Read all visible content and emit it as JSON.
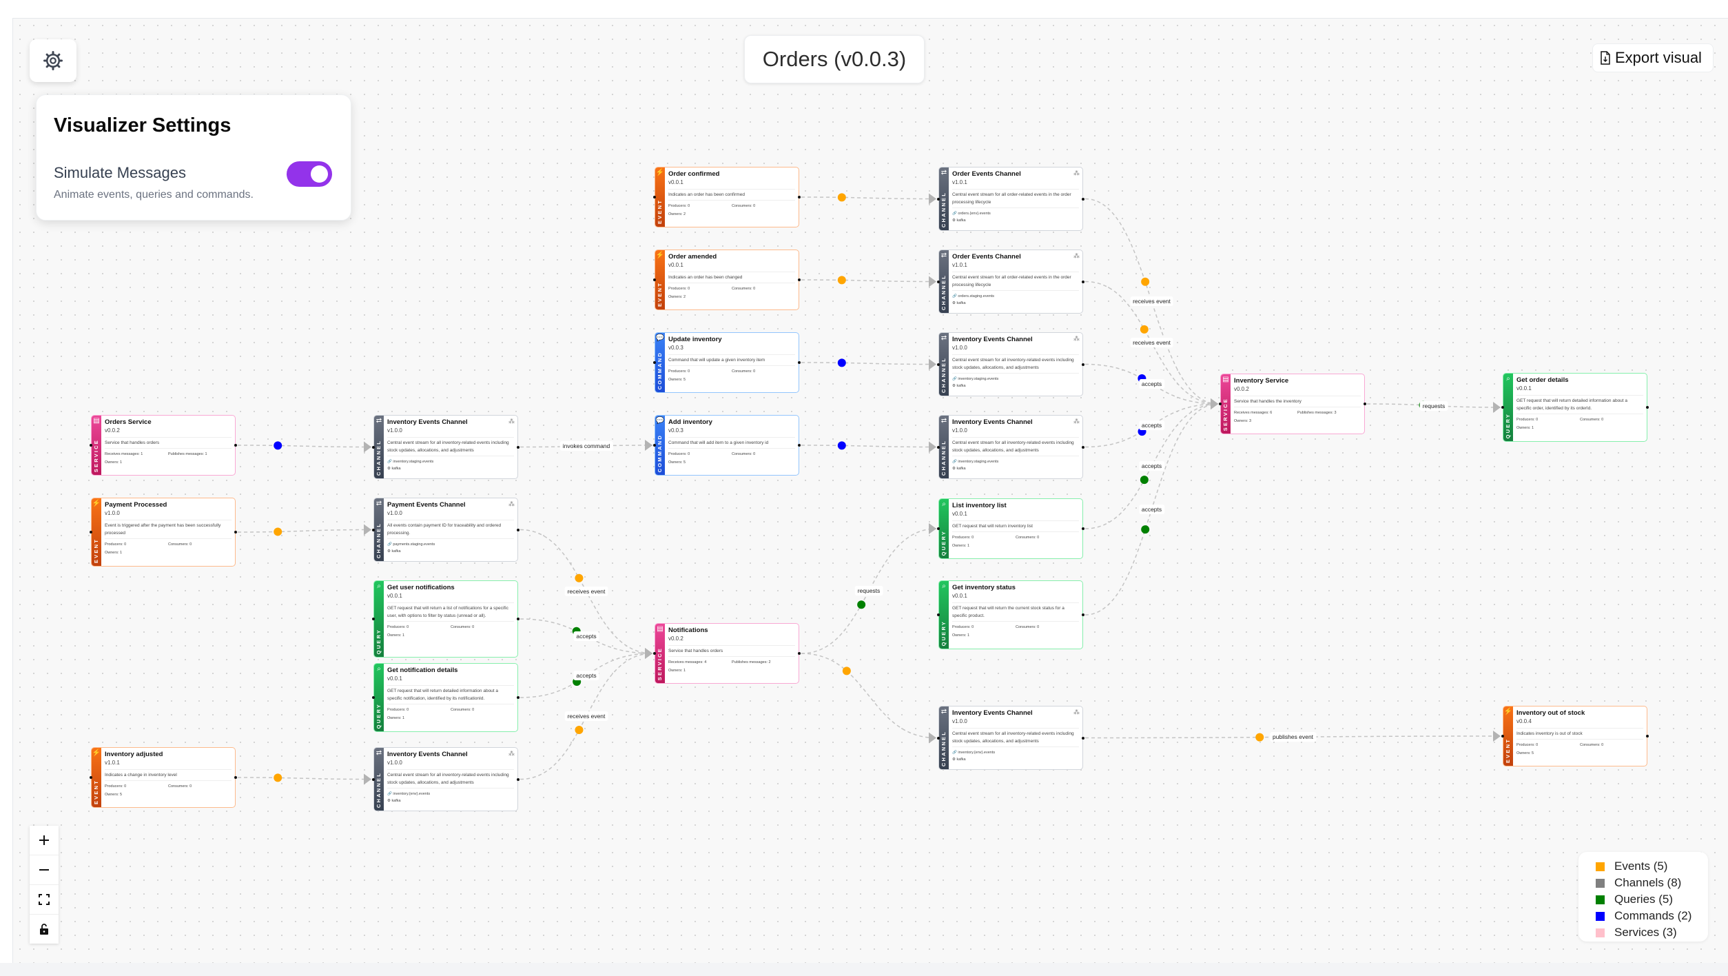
{
  "header": {
    "title": "Orders (v0.0.3)",
    "export_label": "Export visual"
  },
  "settings": {
    "title": "Visualizer Settings",
    "simulate_label": "Simulate Messages",
    "simulate_desc": "Animate events, queries and commands.",
    "simulate_enabled": true
  },
  "colors": {
    "event": "#f97316",
    "channel": "#4b5563",
    "command": "#2563eb",
    "query": "#16a34a",
    "service": "#db2777",
    "toggle": "#9333ea",
    "dot_event": "#ffa500",
    "dot_command": "#0000ff",
    "dot_query": "#008000"
  },
  "legend": [
    {
      "label": "Events (5)",
      "color": "#ffa500"
    },
    {
      "label": "Channels (8)",
      "color": "#808080"
    },
    {
      "label": "Queries (5)",
      "color": "#008000"
    },
    {
      "label": "Commands (2)",
      "color": "#0000ff"
    },
    {
      "label": "Services (3)",
      "color": "#ffc0cb"
    }
  ],
  "zoom_controls": [
    {
      "name": "zoom-in-button",
      "icon": "plus-icon"
    },
    {
      "name": "zoom-out-button",
      "icon": "minus-icon"
    },
    {
      "name": "fit-view-button",
      "icon": "fit-view-icon"
    },
    {
      "name": "toggle-interactivity-button",
      "icon": "unlock-icon"
    }
  ],
  "nodes": [
    {
      "id": "order-confirmed",
      "kind": "event",
      "band": "EVENT",
      "title": "Order confirmed",
      "version": "v0.0.1",
      "desc": "Indicates an order has been confirmed",
      "meta_left": "Producers: 0",
      "meta_right": "Consumers: 0",
      "owners": "Owners: 2"
    },
    {
      "id": "order-amended",
      "kind": "event",
      "band": "EVENT",
      "title": "Order amended",
      "version": "v0.0.1",
      "desc": "Indicates an order has been changed",
      "meta_left": "Producers: 0",
      "meta_right": "Consumers: 0",
      "owners": "Owners: 2"
    },
    {
      "id": "update-inventory",
      "kind": "command",
      "band": "COMMAND",
      "title": "Update inventory",
      "version": "v0.0.3",
      "desc": "Command that will update a given inventory item",
      "meta_left": "Producers: 0",
      "meta_right": "Consumers: 0",
      "owners": "Owners: 5"
    },
    {
      "id": "add-inventory",
      "kind": "command",
      "band": "COMMAND",
      "title": "Add inventory",
      "version": "v0.0.3",
      "desc": "Command that will add item to a given inventory id",
      "meta_left": "Producers: 0",
      "meta_right": "Consumers: 0",
      "owners": "Owners: 5"
    },
    {
      "id": "order-events-channel-1",
      "kind": "channel",
      "band": "CHANNEL",
      "title": "Order Events Channel",
      "version": "v1.0.1",
      "desc": "Central event stream for all order-related events in the order processing lifecycle",
      "topic": "orders.{env}.events",
      "broker": "kafka"
    },
    {
      "id": "order-events-channel-2",
      "kind": "channel",
      "band": "CHANNEL",
      "title": "Order Events Channel",
      "version": "v1.0.1",
      "desc": "Central event stream for all order-related events in the order processing lifecycle",
      "topic": "orders.staging.events",
      "broker": "kafka"
    },
    {
      "id": "inventory-events-channel-1",
      "kind": "channel",
      "band": "CHANNEL",
      "title": "Inventory Events Channel",
      "version": "v1.0.0",
      "desc": "Central event stream for all inventory-related events including stock updates, allocations, and adjustments",
      "topic": "inventory.staging.events",
      "broker": "kafka"
    },
    {
      "id": "inventory-events-channel-2",
      "kind": "channel",
      "band": "CHANNEL",
      "title": "Inventory Events Channel",
      "version": "v1.0.0",
      "desc": "Central event stream for all inventory-related events including stock updates, allocations, and adjustments",
      "topic": "inventory.staging.events",
      "broker": "kafka"
    },
    {
      "id": "orders-service",
      "kind": "service",
      "band": "SERVICE",
      "title": "Orders Service",
      "version": "v0.0.2",
      "desc": "Service that handles orders",
      "meta_left": "Receives messages: 1",
      "meta_right": "Publishes messages: 1",
      "owners": "Owners: 1"
    },
    {
      "id": "inventory-events-channel-3",
      "kind": "channel",
      "band": "CHANNEL",
      "title": "Inventory Events Channel",
      "version": "v1.0.0",
      "desc": "Central event stream for all inventory-related events including stock updates, allocations, and adjustments",
      "topic": "inventory.staging.events",
      "broker": "kafka"
    },
    {
      "id": "payment-processed",
      "kind": "event",
      "band": "EVENT",
      "title": "Payment Processed",
      "version": "v1.0.0",
      "desc": "Event is triggered after the payment has been successfully processed",
      "meta_left": "Producers: 0",
      "meta_right": "Consumers: 0",
      "owners": "Owners: 1"
    },
    {
      "id": "payment-events-channel",
      "kind": "channel",
      "band": "CHANNEL",
      "title": "Payment Events Channel",
      "version": "v1.0.0",
      "desc": "All events contain payment ID for traceability and ordered processing.",
      "topic": "payments.staging.events",
      "broker": "kafka"
    },
    {
      "id": "get-user-notifications",
      "kind": "query",
      "band": "QUERY",
      "title": "Get user notifications",
      "version": "v0.0.1",
      "desc": "GET request that will return a list of notifications for a specific user, with options to filter by status (unread or all).",
      "meta_left": "Producers: 0",
      "meta_right": "Consumers: 0",
      "owners": "Owners: 1"
    },
    {
      "id": "get-notification-details",
      "kind": "query",
      "band": "QUERY",
      "title": "Get notification details",
      "version": "v0.0.1",
      "desc": "GET request that will return detailed information about a specific notification, identified by its notificationId.",
      "meta_left": "Producers: 0",
      "meta_right": "Consumers: 0",
      "owners": "Owners: 1"
    },
    {
      "id": "inventory-adjusted",
      "kind": "event",
      "band": "EVENT",
      "title": "Inventory adjusted",
      "version": "v1.0.1",
      "desc": "Indicates a change in inventory level",
      "meta_left": "Producers: 0",
      "meta_right": "Consumers: 0",
      "owners": "Owners: 5"
    },
    {
      "id": "inventory-events-channel-4",
      "kind": "channel",
      "band": "CHANNEL",
      "title": "Inventory Events Channel",
      "version": "v1.0.0",
      "desc": "Central event stream for all inventory-related events including stock updates, allocations, and adjustments",
      "topic": "inventory.{env}.events",
      "broker": "kafka"
    },
    {
      "id": "notifications",
      "kind": "service",
      "band": "SERVICE",
      "title": "Notifications",
      "version": "v0.0.2",
      "desc": "Service that handles orders",
      "meta_left": "Receives messages: 4",
      "meta_right": "Publishes messages: 2",
      "owners": "Owners: 1"
    },
    {
      "id": "list-inventory-list",
      "kind": "query",
      "band": "QUERY",
      "title": "List inventory list",
      "version": "v0.0.1",
      "desc": "GET request that will return inventory list",
      "meta_left": "Producers: 0",
      "meta_right": "Consumers: 0",
      "owners": "Owners: 1"
    },
    {
      "id": "get-inventory-status",
      "kind": "query",
      "band": "QUERY",
      "title": "Get inventory status",
      "version": "v0.0.1",
      "desc": "GET request that will return the current stock status for a specific product.",
      "meta_left": "Producers: 0",
      "meta_right": "Consumers: 0",
      "owners": "Owners: 1"
    },
    {
      "id": "inventory-events-channel-5",
      "kind": "channel",
      "band": "CHANNEL",
      "title": "Inventory Events Channel",
      "version": "v1.0.0",
      "desc": "Central event stream for all inventory-related events including stock updates, allocations, and adjustments",
      "topic": "inventory.{env}.events",
      "broker": "kafka"
    },
    {
      "id": "inventory-service",
      "kind": "service",
      "band": "SERVICE",
      "title": "Inventory Service",
      "version": "v0.0.2",
      "desc": "Service that handles the inventory",
      "meta_left": "Receives messages: 6",
      "meta_right": "Publishes messages: 3",
      "owners": "Owners: 3"
    },
    {
      "id": "get-order-details",
      "kind": "query",
      "band": "QUERY",
      "title": "Get order details",
      "version": "v0.0.1",
      "desc": "GET request that will return detailed information about a specific order, identified by its orderId.",
      "meta_left": "Producers: 0",
      "meta_right": "Consumers: 0",
      "owners": "Owners: 1"
    },
    {
      "id": "inventory-out-of-stock",
      "kind": "event",
      "band": "EVENT",
      "title": "Inventory out of stock",
      "version": "v0.0.4",
      "desc": "Indicates inventory is out of stock",
      "meta_left": "Producers: 0",
      "meta_right": "Consumers: 0",
      "owners": "Owners: 5"
    }
  ],
  "edges": [
    {
      "from": "order-confirmed",
      "to": "order-events-channel-1",
      "label": "",
      "dot": "event"
    },
    {
      "from": "order-amended",
      "to": "order-events-channel-2",
      "label": "",
      "dot": "event"
    },
    {
      "from": "update-inventory",
      "to": "inventory-events-channel-1",
      "label": "",
      "dot": "command"
    },
    {
      "from": "add-inventory",
      "to": "inventory-events-channel-2",
      "label": "",
      "dot": "command"
    },
    {
      "from": "orders-service",
      "to": "inventory-events-channel-3",
      "label": "",
      "dot": "command"
    },
    {
      "from": "inventory-events-channel-3",
      "to": "add-inventory",
      "label": "invokes command",
      "dot": "command"
    },
    {
      "from": "payment-processed",
      "to": "payment-events-channel",
      "label": "",
      "dot": "event"
    },
    {
      "from": "inventory-adjusted",
      "to": "inventory-events-channel-4",
      "label": "",
      "dot": "event"
    },
    {
      "from": "payment-events-channel",
      "to": "notifications",
      "label": "receives event",
      "dot": "event"
    },
    {
      "from": "get-user-notifications",
      "to": "notifications",
      "label": "accepts",
      "dot": "query"
    },
    {
      "from": "get-notification-details",
      "to": "notifications",
      "label": "accepts",
      "dot": "query"
    },
    {
      "from": "inventory-events-channel-4",
      "to": "notifications",
      "label": "receives event",
      "dot": "event"
    },
    {
      "from": "notifications",
      "to": "list-inventory-list",
      "label": "requests",
      "dot": "query"
    },
    {
      "from": "notifications",
      "to": "inventory-events-channel-5",
      "label": "",
      "dot": "event"
    },
    {
      "from": "order-events-channel-1",
      "to": "inventory-service",
      "label": "receives event",
      "dot": "event"
    },
    {
      "from": "order-events-channel-2",
      "to": "inventory-service",
      "label": "receives event",
      "dot": "event"
    },
    {
      "from": "inventory-events-channel-1",
      "to": "inventory-service",
      "label": "accepts",
      "dot": "command"
    },
    {
      "from": "inventory-events-channel-2",
      "to": "inventory-service",
      "label": "accepts",
      "dot": "command"
    },
    {
      "from": "list-inventory-list",
      "to": "inventory-service",
      "label": "accepts",
      "dot": "query"
    },
    {
      "from": "get-inventory-status",
      "to": "inventory-service",
      "label": "accepts",
      "dot": "query"
    },
    {
      "from": "inventory-service",
      "to": "get-order-details",
      "label": "requests",
      "dot": "query"
    },
    {
      "from": "inventory-events-channel-5",
      "to": "inventory-out-of-stock",
      "label": "publishes event",
      "dot": "event"
    }
  ]
}
